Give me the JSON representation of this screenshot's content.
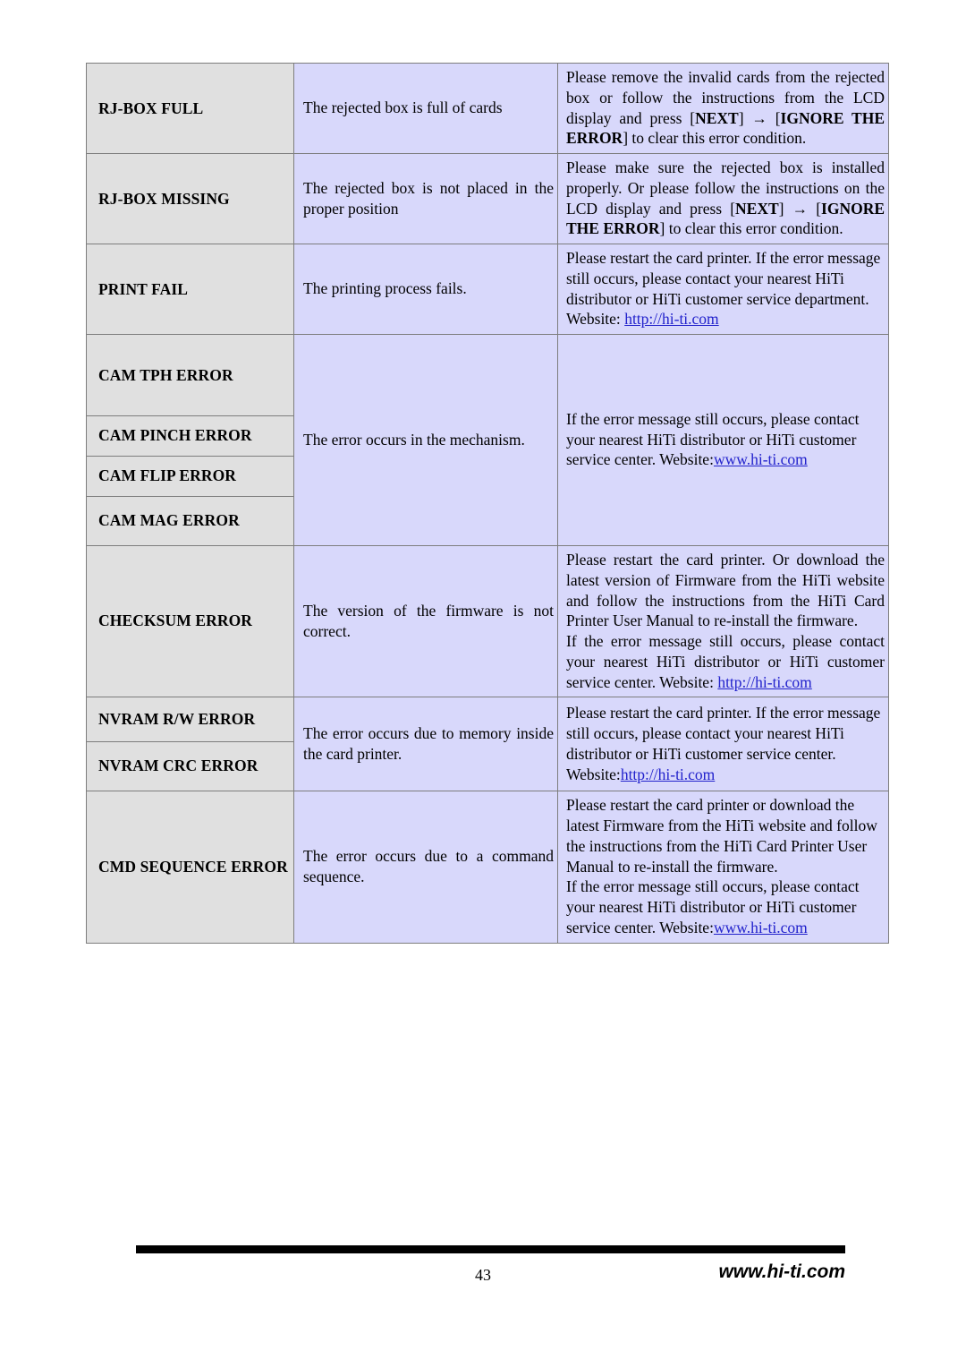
{
  "document": {
    "page_number": "43",
    "footer_url": "www.hi-ti.com"
  },
  "colors": {
    "code_cell_bg": "#e0e0e0",
    "text_cell_bg": "#d8d8fb",
    "border": "#7d7d7d",
    "link": "#2222cc",
    "footer_bar": "#000000"
  },
  "table": {
    "rows": [
      {
        "code": "RJ-BOX FULL",
        "description": "The rejected box is full of cards",
        "solution": {
          "seg1": "Please remove the invalid cards from the rejected box or follow the instructions from the LCD display and press [",
          "bold1": "NEXT",
          "seg2": "] ",
          "arrow": "→",
          "seg3": " [",
          "bold2": "IGNORE THE ERROR",
          "seg4": "] to clear this error condition."
        }
      },
      {
        "code": "RJ-BOX MISSING",
        "description": "The rejected box is not placed in the proper position",
        "solution": {
          "seg1": "Please make sure the rejected box is installed properly. Or please follow the instructions on the LCD display and press [",
          "bold1": "NEXT",
          "seg2": "] ",
          "arrow": "→",
          "seg3": " [",
          "bold2": "IGNORE THE ERROR",
          "seg4": "] to clear this error condition."
        }
      },
      {
        "code": "PRINT FAIL",
        "description": "The printing process fails.",
        "solution": {
          "text": "Please restart the card printer. If the error message still occurs, please contact your nearest HiTi distributor or HiTi customer service department. Website: ",
          "link": "http://hi-ti.com"
        }
      },
      {
        "code": "CAM TPH ERROR",
        "group": "cam"
      },
      {
        "code": "CAM PINCH ERROR",
        "group": "cam",
        "description": "The error occurs in the mechanism.",
        "solution": {
          "text": "If the error message still occurs, please contact your nearest HiTi distributor or HiTi customer service center. Website:",
          "link": "www.hi-ti.com"
        }
      },
      {
        "code": "CAM FLIP ERROR",
        "group": "cam"
      },
      {
        "code": "CAM MAG ERROR",
        "group": "cam"
      },
      {
        "code": "CHECKSUM ERROR",
        "description": "The version of the firmware is not correct.",
        "solution": {
          "text": "Please restart the card printer. Or download the latest version of Firmware from the HiTi website and follow the instructions from the HiTi Card Printer User Manual to re-install the firmware.",
          "text2": "If the error message still occurs, please contact your nearest HiTi distributor or HiTi customer service center. Website: ",
          "link": "http://hi-ti.com"
        }
      },
      {
        "code": "NVRAM R/W ERROR",
        "group": "nvram",
        "description": "The error occurs due to memory inside the card printer.",
        "solution": {
          "text": "Please restart the card printer. If the error message still occurs, please contact your nearest HiTi distributor or HiTi customer service center. Website:",
          "link": "http://hi-ti.com"
        }
      },
      {
        "code": "NVRAM CRC ERROR",
        "group": "nvram"
      },
      {
        "code": "CMD SEQUENCE ERROR",
        "description": "The error occurs due to a command sequence.",
        "solution": {
          "text": "Please restart the card printer or download the latest Firmware from the HiTi website and follow the instructions from the HiTi Card Printer User Manual to re-install the firmware.",
          "text2": "If the error message still occurs, please contact your nearest HiTi distributor or HiTi customer service center. Website:",
          "link": "www.hi-ti.com"
        }
      }
    ]
  }
}
